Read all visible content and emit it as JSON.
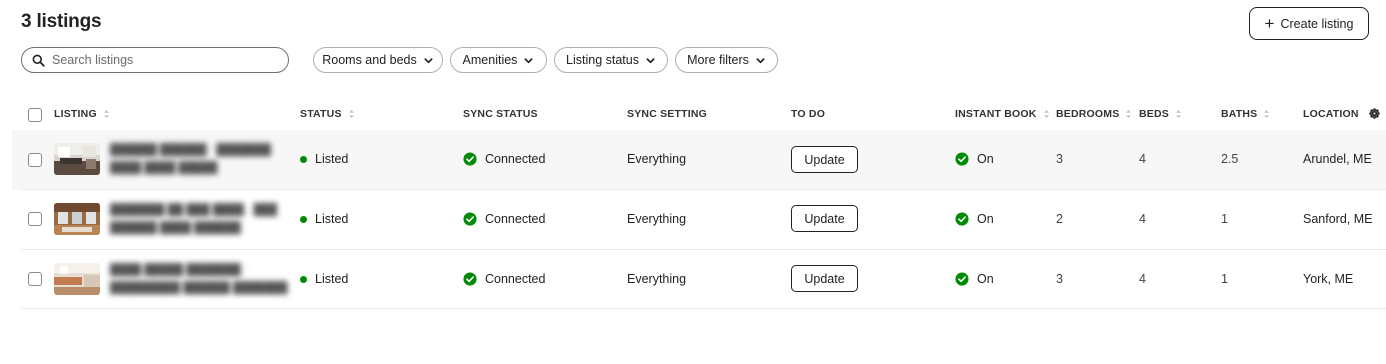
{
  "header": {
    "title": "3 listings",
    "create_label": "Create listing"
  },
  "search": {
    "placeholder": "Search listings",
    "value": ""
  },
  "filters": [
    {
      "label": "Rooms and beds"
    },
    {
      "label": "Amenities"
    },
    {
      "label": "Listing status"
    },
    {
      "label": "More filters"
    }
  ],
  "table": {
    "columns": [
      {
        "label": "LISTING",
        "sortable": true
      },
      {
        "label": "STATUS",
        "sortable": true
      },
      {
        "label": "SYNC STATUS",
        "sortable": false
      },
      {
        "label": "SYNC SETTING",
        "sortable": false
      },
      {
        "label": "TO DO",
        "sortable": false
      },
      {
        "label": "INSTANT BOOK",
        "sortable": true
      },
      {
        "label": "BEDROOMS",
        "sortable": true
      },
      {
        "label": "BEDS",
        "sortable": true
      },
      {
        "label": "BATHS",
        "sortable": true
      },
      {
        "label": "LOCATION",
        "sortable": false
      }
    ],
    "rows": [
      {
        "status": "Listed",
        "sync_status": "Connected",
        "sync_setting": "Everything",
        "todo": "Update",
        "instant_book": "On",
        "bedrooms": "3",
        "beds": "4",
        "baths": "2.5",
        "location": "Arundel, ME"
      },
      {
        "status": "Listed",
        "sync_status": "Connected",
        "sync_setting": "Everything",
        "todo": "Update",
        "instant_book": "On",
        "bedrooms": "2",
        "beds": "4",
        "baths": "1",
        "location": "Sanford, ME"
      },
      {
        "status": "Listed",
        "sync_status": "Connected",
        "sync_setting": "Everything",
        "todo": "Update",
        "instant_book": "On",
        "bedrooms": "3",
        "beds": "4",
        "baths": "1",
        "location": "York, ME"
      }
    ]
  },
  "colors": {
    "listed_dot": "#008a05",
    "connected_check": "#008a05",
    "text": "#222222"
  },
  "icons": {
    "search": "search-icon",
    "plus": "plus-icon",
    "chevron": "chevron-down-icon",
    "sort": "sort-icon",
    "check": "check-circle-icon",
    "settings": "gear-icon"
  }
}
